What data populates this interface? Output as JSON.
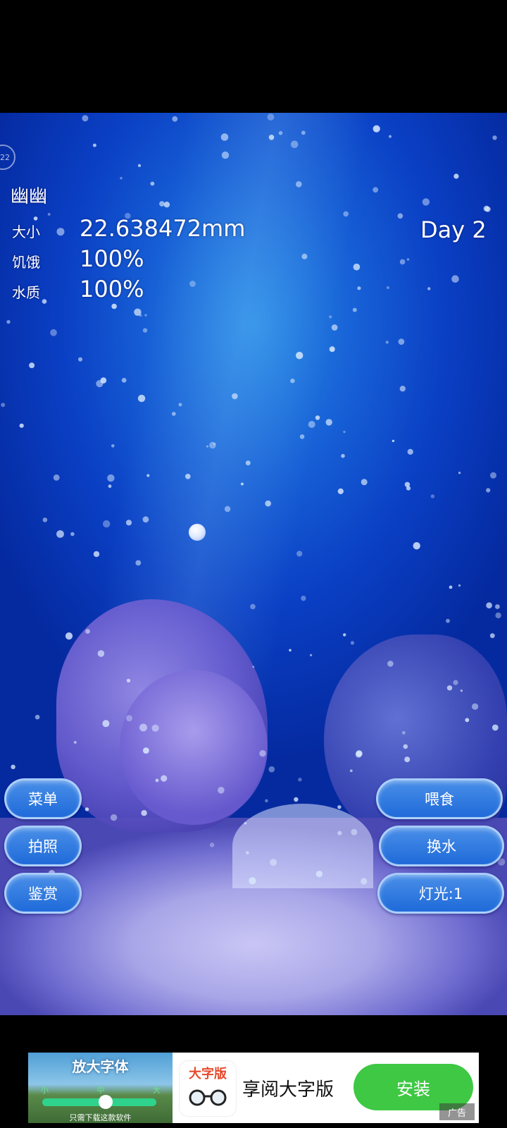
{
  "hud": {
    "pet_name": "幽幽",
    "help_badge": "22",
    "size_label": "大小",
    "size_value": "22.638472mm",
    "hunger_label": "饥饿",
    "hunger_value": "100%",
    "water_label": "水质",
    "water_value": "100%",
    "day": "Day 2"
  },
  "buttons": {
    "menu": "菜单",
    "photo": "拍照",
    "appreciate": "鉴赏",
    "feed": "喂食",
    "change_water": "换水",
    "light": "灯光:1"
  },
  "ad": {
    "image_title": "放大字体",
    "image_ticks": [
      "小",
      "中",
      "大"
    ],
    "image_subtitle": "只需下载这款软件",
    "icon_title": "大字版",
    "title": "享阅大字版",
    "install_label": "安装",
    "tag": "广告"
  },
  "colors": {
    "water_deep": "#052aa0",
    "water_light": "#2a8de6",
    "button_blue": "#1e6ad9",
    "install_green": "#3ec843"
  }
}
